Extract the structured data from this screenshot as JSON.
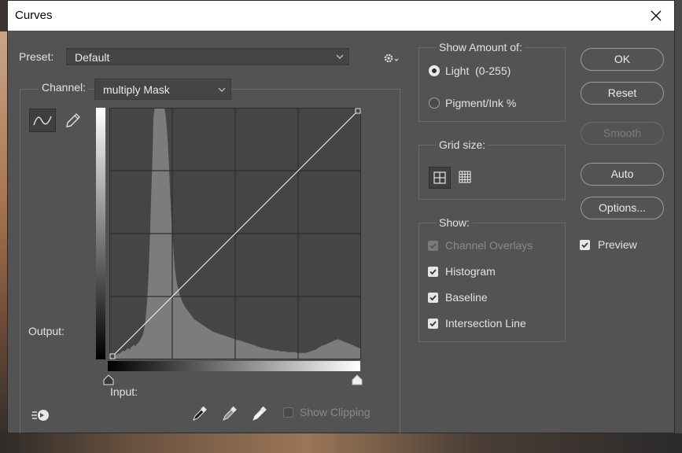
{
  "window": {
    "title": "Curves"
  },
  "preset": {
    "label": "Preset:",
    "value": "Default"
  },
  "channel": {
    "label": "Channel:",
    "value": "multiply Mask"
  },
  "axes": {
    "output_label": "Output:",
    "input_label": "Input:"
  },
  "show_clipping": {
    "label": "Show Clipping",
    "checked": false,
    "enabled": false
  },
  "show_amount": {
    "title": "Show Amount of:",
    "light_label": "Light  (0-255)",
    "pigment_label": "Pigment/Ink %",
    "selected": "light"
  },
  "grid_size": {
    "title": "Grid size:",
    "selected": "simple"
  },
  "show": {
    "title": "Show:",
    "items": [
      {
        "label": "Channel Overlays",
        "checked": true,
        "enabled": false
      },
      {
        "label": "Histogram",
        "checked": true,
        "enabled": true
      },
      {
        "label": "Baseline",
        "checked": true,
        "enabled": true
      },
      {
        "label": "Intersection Line",
        "checked": true,
        "enabled": true
      }
    ]
  },
  "buttons": {
    "ok": "OK",
    "reset": "Reset",
    "smooth": "Smooth",
    "auto": "Auto",
    "options": "Options..."
  },
  "preview": {
    "label": "Preview",
    "checked": true
  },
  "histogram": {
    "values": [
      2,
      3,
      3,
      4,
      4,
      5,
      6,
      7,
      7,
      8,
      9,
      10,
      11,
      10,
      12,
      13,
      14,
      12,
      15,
      16,
      17,
      18,
      16,
      19,
      20,
      22,
      24,
      27,
      30,
      36,
      45,
      60,
      80,
      110,
      150,
      200,
      245,
      300,
      312,
      312,
      312,
      312,
      312,
      312,
      312,
      312,
      312,
      305,
      290,
      270,
      240,
      205,
      175,
      150,
      130,
      112,
      100,
      92,
      86,
      80,
      76,
      72,
      69,
      66,
      64,
      62,
      60,
      58,
      56,
      54,
      52,
      50,
      49,
      48,
      47,
      46,
      45,
      44,
      43,
      42,
      41,
      40,
      39,
      38,
      37,
      36,
      35,
      34,
      34,
      33,
      33,
      32,
      32,
      31,
      31,
      30,
      30,
      29,
      29,
      28,
      28,
      27,
      27,
      26,
      26,
      25,
      25,
      24,
      24,
      24,
      23,
      23,
      22,
      22,
      21,
      21,
      20,
      20,
      19,
      19,
      18,
      18,
      17,
      17,
      16,
      16,
      15,
      15,
      14,
      14,
      14,
      13,
      13,
      13,
      12,
      12,
      12,
      12,
      11,
      11,
      11,
      11,
      11,
      10,
      10,
      10,
      10,
      10,
      10,
      9,
      9,
      9,
      9,
      9,
      9,
      9,
      9,
      8,
      8,
      8,
      8,
      8,
      8,
      8,
      8,
      8,
      9,
      9,
      10,
      10,
      11,
      11,
      12,
      12,
      13,
      14,
      15,
      16,
      17,
      17,
      18,
      18,
      19,
      20,
      20,
      21,
      22,
      22,
      23,
      24,
      24,
      25,
      25,
      24,
      24,
      23,
      22,
      22,
      21,
      21,
      20,
      20,
      19,
      18,
      18,
      17,
      16,
      16,
      15,
      14,
      14,
      13
    ]
  },
  "curve": {
    "points": [
      [
        0,
        0
      ],
      [
        255,
        255
      ]
    ]
  }
}
